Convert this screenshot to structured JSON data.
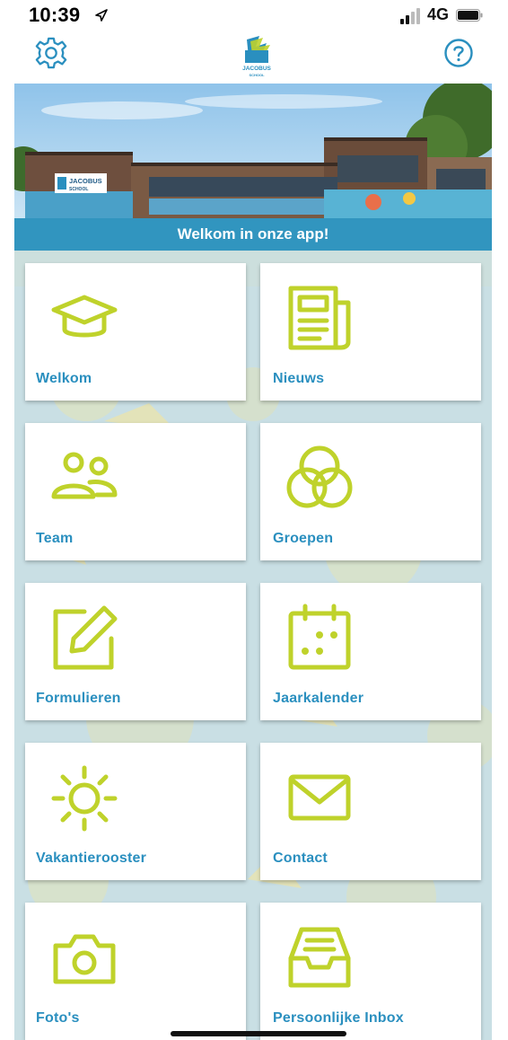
{
  "status_bar": {
    "time": "10:39",
    "network": "4G"
  },
  "header": {
    "logo_text": "JACOBUS",
    "logo_subtext": "SCHOOL"
  },
  "hero": {
    "caption": "Welkom in onze app!",
    "sign_text": "JACOBUS",
    "sign_subtext": "SCHOOL"
  },
  "tiles": [
    {
      "label": "Welkom",
      "icon": "graduation-cap-icon"
    },
    {
      "label": "Nieuws",
      "icon": "newspaper-icon"
    },
    {
      "label": "Team",
      "icon": "people-icon"
    },
    {
      "label": "Groepen",
      "icon": "circles-icon"
    },
    {
      "label": "Formulieren",
      "icon": "edit-form-icon"
    },
    {
      "label": "Jaarkalender",
      "icon": "calendar-icon"
    },
    {
      "label": "Vakantierooster",
      "icon": "sun-icon"
    },
    {
      "label": "Contact",
      "icon": "envelope-icon"
    },
    {
      "label": "Foto's",
      "icon": "camera-icon"
    },
    {
      "label": "Persoonlijke Inbox",
      "icon": "inbox-tray-icon"
    }
  ],
  "colors": {
    "accent_green": "#bfd22b",
    "label_blue": "#2a8fbf",
    "banner_blue": "#2996c4",
    "pattern_bg": "#c9dfe4",
    "pattern_fg": "#e6e4b4"
  }
}
